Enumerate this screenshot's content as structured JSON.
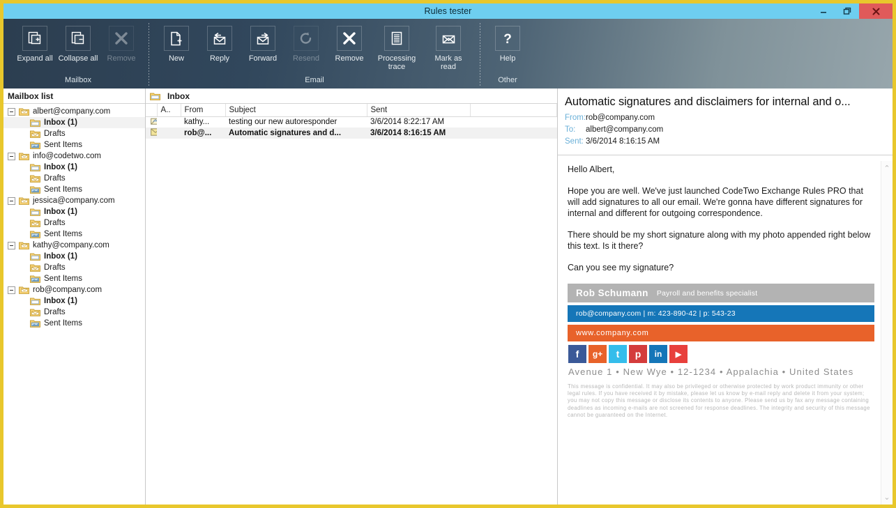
{
  "window": {
    "title": "Rules tester",
    "controls": {
      "minimize_label": "Minimize",
      "restore_label": "Restore",
      "close_label": "Close"
    },
    "frame_color": "#e8c72c",
    "titlebar_color": "#6ecef0"
  },
  "ribbon": {
    "groups": [
      {
        "name": "Mailbox",
        "label": "Mailbox",
        "items": [
          {
            "label": "Expand all",
            "icon": "expand-all-icon",
            "disabled": false
          },
          {
            "label": "Collapse all",
            "icon": "collapse-all-icon",
            "disabled": false
          },
          {
            "label": "Remove",
            "icon": "remove-x-icon",
            "disabled": true
          }
        ]
      },
      {
        "name": "Email",
        "label": "Email",
        "items": [
          {
            "label": "New",
            "icon": "new-message-icon",
            "disabled": false
          },
          {
            "label": "Reply",
            "icon": "reply-icon",
            "disabled": false
          },
          {
            "label": "Forward",
            "icon": "forward-icon",
            "disabled": false
          },
          {
            "label": "Resend",
            "icon": "resend-refresh-icon",
            "disabled": true
          },
          {
            "label": "Remove",
            "icon": "remove-x-icon",
            "disabled": false
          },
          {
            "label": "Processing\ntrace",
            "icon": "document-lines-icon",
            "disabled": false
          },
          {
            "label": "Mark as\nread",
            "icon": "open-envelope-icon",
            "disabled": false
          }
        ]
      },
      {
        "name": "Other",
        "label": "Other",
        "items": [
          {
            "label": "Help",
            "icon": "question-mark-icon",
            "disabled": false
          }
        ]
      }
    ]
  },
  "mailbox_pane": {
    "header": "Mailbox list",
    "watermark": "",
    "accounts": [
      {
        "email": "albert@company.com",
        "folders": [
          {
            "label": "Inbox (1)",
            "bold": true,
            "icon": "inbox-folder-icon",
            "selected": true
          },
          {
            "label": "Drafts",
            "bold": false,
            "icon": "drafts-folder-icon",
            "selected": false
          },
          {
            "label": "Sent Items",
            "bold": false,
            "icon": "sent-folder-icon",
            "selected": false
          }
        ]
      },
      {
        "email": "info@codetwo.com",
        "folders": [
          {
            "label": "Inbox (1)",
            "bold": true,
            "icon": "inbox-folder-icon",
            "selected": false
          },
          {
            "label": "Drafts",
            "bold": false,
            "icon": "drafts-folder-icon",
            "selected": false
          },
          {
            "label": "Sent Items",
            "bold": false,
            "icon": "sent-folder-icon",
            "selected": false
          }
        ]
      },
      {
        "email": "jessica@company.com",
        "folders": [
          {
            "label": "Inbox (1)",
            "bold": true,
            "icon": "inbox-folder-icon",
            "selected": false
          },
          {
            "label": "Drafts",
            "bold": false,
            "icon": "drafts-folder-icon",
            "selected": false
          },
          {
            "label": "Sent Items",
            "bold": false,
            "icon": "sent-folder-icon",
            "selected": false
          }
        ]
      },
      {
        "email": "kathy@company.com",
        "folders": [
          {
            "label": "Inbox (1)",
            "bold": true,
            "icon": "inbox-folder-icon",
            "selected": false
          },
          {
            "label": "Drafts",
            "bold": false,
            "icon": "drafts-folder-icon",
            "selected": false
          },
          {
            "label": "Sent Items",
            "bold": false,
            "icon": "sent-folder-icon",
            "selected": false
          }
        ]
      },
      {
        "email": "rob@company.com",
        "folders": [
          {
            "label": "Inbox (1)",
            "bold": true,
            "icon": "inbox-folder-icon",
            "selected": false
          },
          {
            "label": "Drafts",
            "bold": false,
            "icon": "drafts-folder-icon",
            "selected": false
          },
          {
            "label": "Sent Items",
            "bold": false,
            "icon": "sent-folder-icon",
            "selected": false
          }
        ]
      }
    ]
  },
  "message_list": {
    "header": "Inbox",
    "columns": [
      "",
      "A..",
      "From",
      "Subject",
      "Sent",
      ""
    ],
    "rows": [
      {
        "icon": "replied-message-icon",
        "attachment": "",
        "from": "kathy...",
        "subject": "testing our new autoresponder",
        "sent": "3/6/2014 8:22:17 AM",
        "selected": false
      },
      {
        "icon": "unread-envelope-icon",
        "attachment": "",
        "from": "rob@...",
        "subject": "Automatic signatures and d...",
        "sent": "3/6/2014 8:16:15 AM",
        "selected": true
      }
    ]
  },
  "reading_pane": {
    "subject": "Automatic signatures and disclaimers for internal and o...",
    "fields": [
      {
        "label": "From:",
        "value": "rob@company.com"
      },
      {
        "label": "To:",
        "value": "albert@company.com"
      },
      {
        "label": "Sent:",
        "value": "3/6/2014 8:16:15 AM"
      }
    ],
    "body_paragraphs": [
      "Hello Albert,",
      "Hope you are well. We've just launched CodeTwo Exchange Rules PRO that will add signatures to all our email. We're gonna have different signatures for internal and different for outgoing correspondence.",
      "There should be my short signature along with my photo appended right below this text. Is it there?",
      "Can you see my signature?"
    ],
    "signature": {
      "name": "Rob Schumann",
      "job_title": "Payroll and benefits specialist",
      "contact": "rob@company.com |  m:  423-890-42 | p: 543-23",
      "website": "www.company.com",
      "address": "Avenue 1 • New Wye  • 12-1234 • Appalachia • United States",
      "colors": {
        "name_bar": "#b3b3b3",
        "contact_bar": "#1576b8",
        "web_bar": "#e8622a"
      },
      "social": [
        {
          "name": "facebook-icon",
          "glyph": "f",
          "color": "#3b5998"
        },
        {
          "name": "googleplus-icon",
          "glyph": "g+",
          "color": "#e8622a"
        },
        {
          "name": "twitter-icon",
          "glyph": "t",
          "color": "#35bdeb"
        },
        {
          "name": "pinterest-icon",
          "glyph": "p",
          "color": "#d43c3c"
        },
        {
          "name": "linkedin-icon",
          "glyph": "in",
          "color": "#1576b8"
        },
        {
          "name": "youtube-icon",
          "glyph": "▶",
          "color": "#e8403c"
        }
      ]
    },
    "disclaimer": "This message is confidential. It may also be privileged or otherwise protected by work product immunity or other legal rules. If you have received it by mistake, please let us know by e-mail reply and delete it from your system; you may not copy this message or disclose its contents to anyone. Please send us by fax any message containing deadlines as incoming e-mails are not screened for response deadlines. The integrity and security of this message cannot be guaranteed on the Internet.",
    "scrollbar": {
      "up": "⌃",
      "down": "⌄"
    }
  }
}
